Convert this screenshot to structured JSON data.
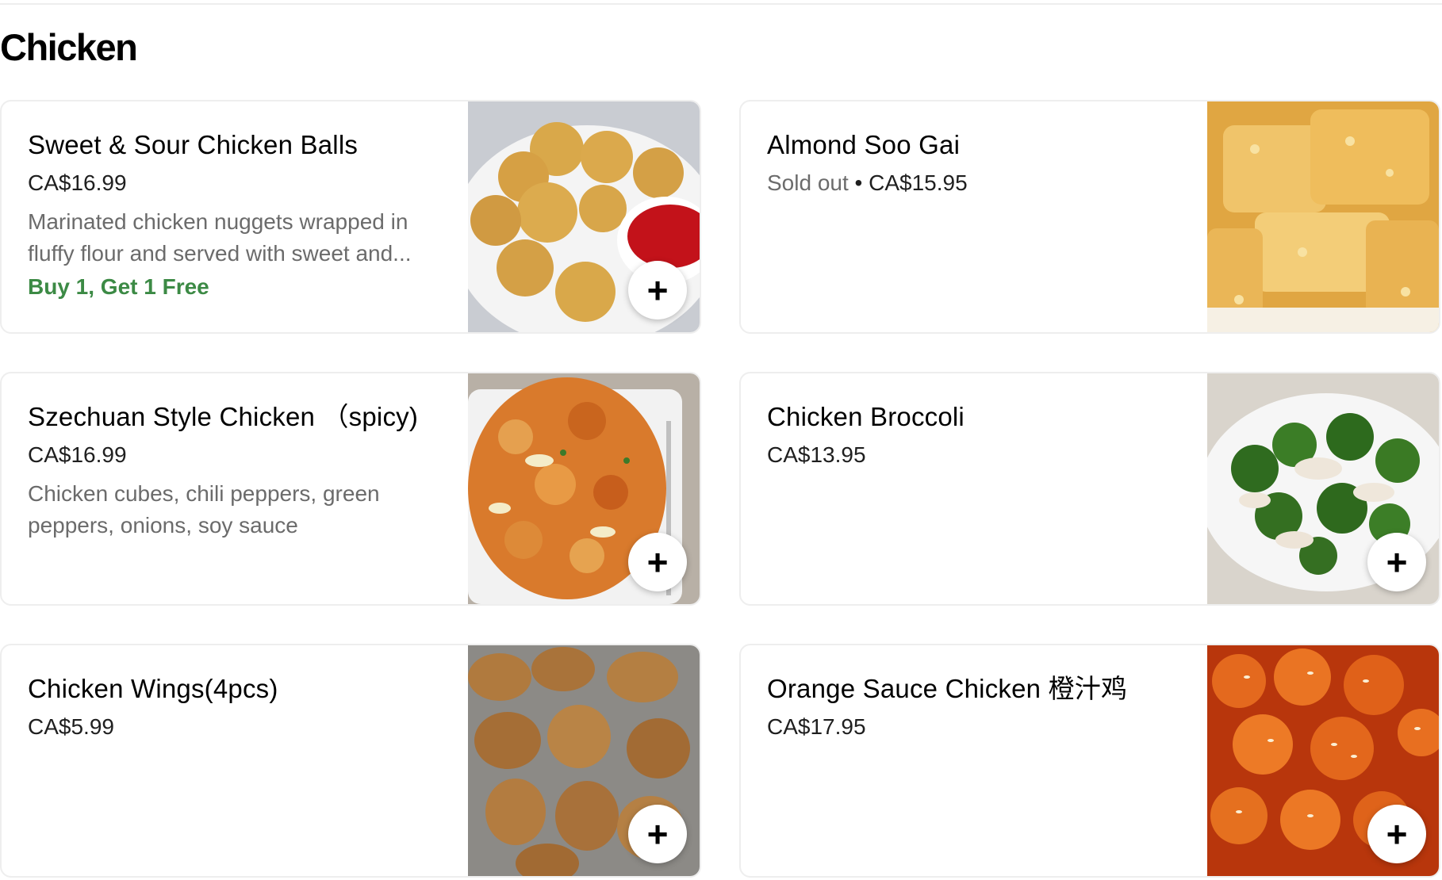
{
  "section": {
    "title": "Chicken"
  },
  "items": [
    {
      "name": "Sweet & Sour Chicken Balls",
      "price": "CA$16.99",
      "description": "Marinated chicken nuggets wrapped in fluffy flour and served with sweet and...",
      "promo": "Buy 1, Get 1 Free",
      "add_label": "+",
      "image_icon": "chicken-balls-image"
    },
    {
      "name": "Almond Soo Gai",
      "status": "Sold out",
      "separator": " • ",
      "price": "CA$15.95",
      "image_icon": "almond-soo-gai-image"
    },
    {
      "name": "Szechuan Style Chicken （spicy)",
      "price": "CA$16.99",
      "description": "Chicken cubes, chili peppers, green peppers, onions, soy sauce",
      "add_label": "+",
      "image_icon": "szechuan-chicken-image"
    },
    {
      "name": "Chicken Broccoli",
      "price": "CA$13.95",
      "add_label": "+",
      "image_icon": "chicken-broccoli-image"
    },
    {
      "name": "Chicken Wings(4pcs)",
      "price": "CA$5.99",
      "add_label": "+",
      "image_icon": "chicken-wings-image"
    },
    {
      "name": "Orange Sauce Chicken 橙汁鸡",
      "price": "CA$17.95",
      "add_label": "+",
      "image_icon": "orange-chicken-image"
    }
  ],
  "colors": {
    "promo": "#3c8a45",
    "muted": "#6b6b6b",
    "border": "#eeeeee"
  }
}
